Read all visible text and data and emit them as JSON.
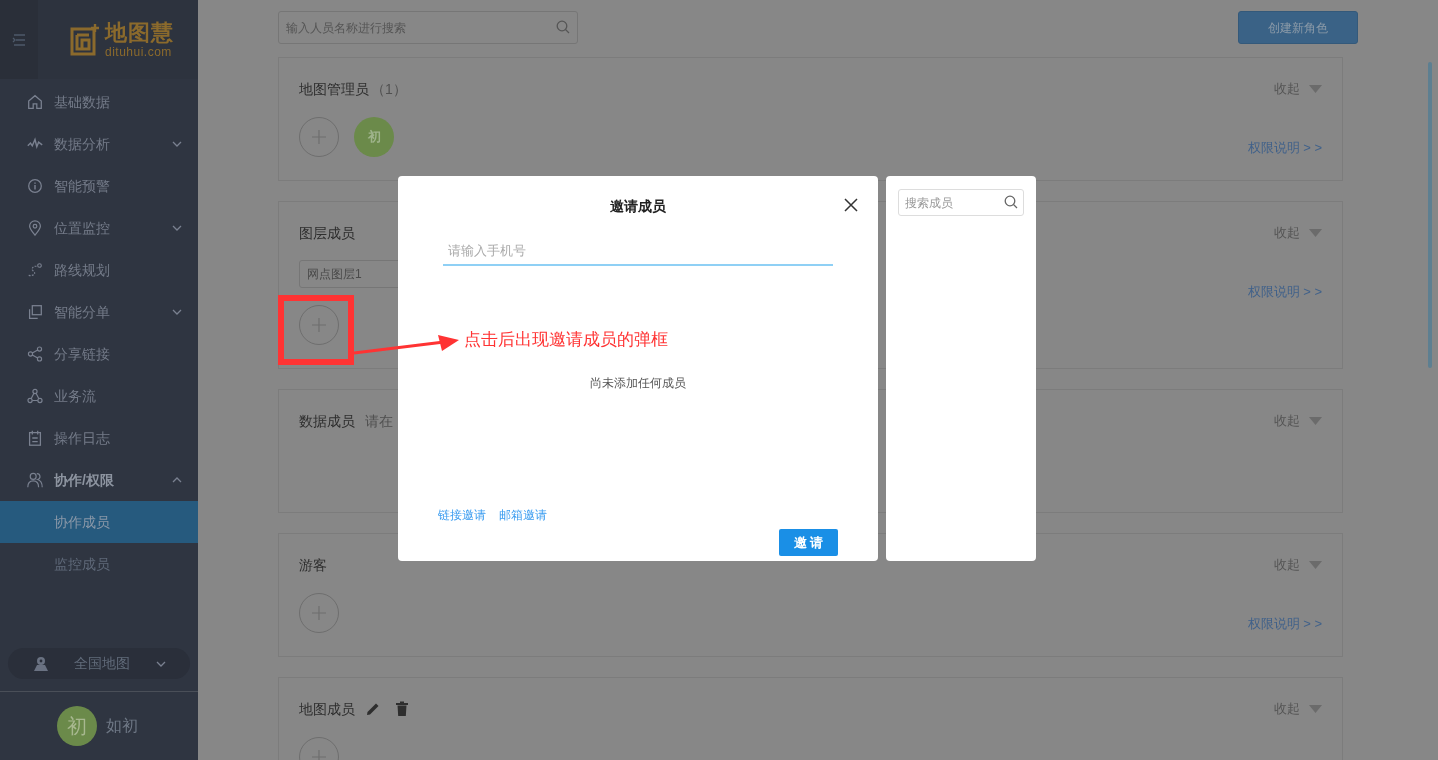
{
  "sidebar": {
    "logo": {
      "name": "地图慧",
      "domain": "dituhui.com"
    },
    "items": [
      {
        "label": "基础数据"
      },
      {
        "label": "数据分析",
        "expanded": false
      },
      {
        "label": "智能预警"
      },
      {
        "label": "位置监控",
        "expanded": false
      },
      {
        "label": "路线规划"
      },
      {
        "label": "智能分单",
        "expanded": false
      },
      {
        "label": "分享链接"
      },
      {
        "label": "业务流"
      },
      {
        "label": "操作日志"
      },
      {
        "label": "协作/权限",
        "expanded": true,
        "children": [
          {
            "label": "协作成员",
            "selected": true
          },
          {
            "label": "监控成员",
            "selected": false
          }
        ]
      }
    ],
    "map_selector": {
      "label": "全国地图"
    },
    "user": {
      "initial": "初",
      "name": "如初"
    }
  },
  "toolbar": {
    "search": {
      "placeholder": "输入人员名称进行搜索"
    },
    "create_button": "创建新角色"
  },
  "sections": [
    {
      "title": "地图管理员",
      "count": "（1）",
      "editable": false,
      "collapse": "收起",
      "add_button": true,
      "members": [
        {
          "initial": "初",
          "color": "#6b8a4a"
        }
      ],
      "permission_link": "权限说明 > >"
    },
    {
      "title": "图层成员",
      "editable": false,
      "collapse": "收起",
      "tags": [
        "网点图层1"
      ],
      "add_button": true,
      "permission_link": "权限说明 > >"
    },
    {
      "title": "数据成员",
      "hint": "请在",
      "editable": false,
      "collapse": "收起",
      "add_button": false
    },
    {
      "title": "游客",
      "editable": false,
      "collapse": "收起",
      "add_button": true,
      "permission_link": "权限说明 > >"
    },
    {
      "title": "地图成员",
      "editable": true,
      "collapse": "收起",
      "add_button": true
    }
  ],
  "invite_dialog": {
    "title": "邀请成员",
    "phone_placeholder": "请输入手机号",
    "empty_text": "尚未添加任何成员",
    "links": [
      "链接邀请",
      "邮箱邀请"
    ],
    "invite_button": "邀 请"
  },
  "member_panel": {
    "search_placeholder": "搜索成员"
  },
  "annotation": {
    "text": "点击后出现邀请成员的弹框"
  }
}
